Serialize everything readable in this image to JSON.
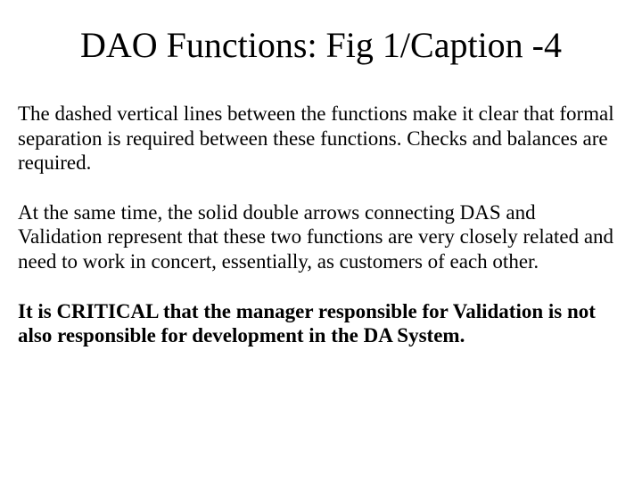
{
  "title": "DAO Functions: Fig 1/Caption -4",
  "paragraphs": {
    "p1": "The dashed vertical lines between the functions make it clear that formal separation is required between these functions.  Checks and balances are required.",
    "p2": "At the same time, the solid double arrows connecting DAS and Validation represent that these two functions are very closely related and need to work in concert, essentially, as customers of each other.",
    "p3": "It is CRITICAL that the manager responsible for Validation is not also responsible for development in the DA System."
  }
}
